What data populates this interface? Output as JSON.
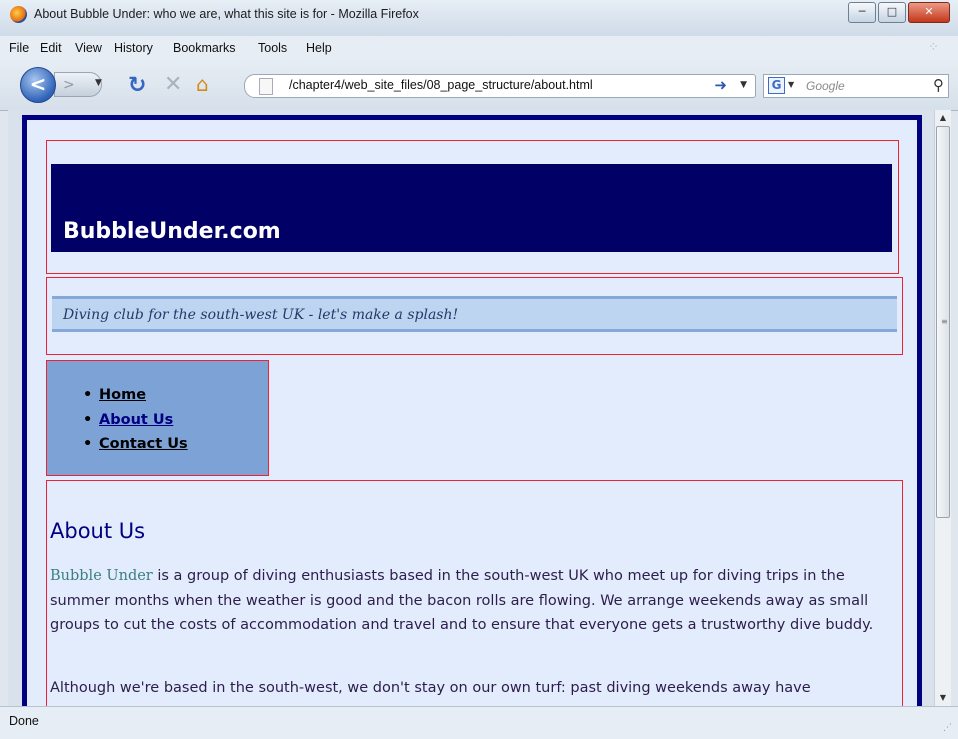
{
  "window": {
    "title": "About Bubble Under: who we are, what this site is for - Mozilla Firefox",
    "controls": {
      "minimize": "─",
      "maximize": "□",
      "close": "✕"
    }
  },
  "menubar": {
    "items": [
      "File",
      "Edit",
      "View",
      "History",
      "Bookmarks",
      "Tools",
      "Help"
    ]
  },
  "navbar": {
    "url": "/chapter4/web_site_files/08_page_structure/about.html",
    "search_placeholder": "Google",
    "search_engine_letter": "G"
  },
  "page": {
    "site_name": "BubbleUnder.com",
    "tagline": "Diving club for the south-west UK - let's make a splash!",
    "nav": [
      {
        "label": "Home"
      },
      {
        "label": "About Us"
      },
      {
        "label": "Contact Us"
      }
    ],
    "content": {
      "heading": "About Us",
      "brand": "Bubble Under",
      "p1_rest": " is a group of diving enthusiasts based in the south-west UK who meet up for diving trips in the summer months when the weather is good and the bacon rolls are flowing. We arrange weekends away as small groups to cut the costs of accommodation and travel and to ensure that everyone gets a trustworthy dive buddy.",
      "p2": "Although we're based in the south-west, we don't stay on our own turf: past diving weekends away have"
    }
  },
  "statusbar": {
    "text": "Done"
  },
  "colors": {
    "page_background": "#e3ecfc",
    "header_bar": "#000066",
    "border_accent": "#000080",
    "debug_outline": "#e22233",
    "nav_background": "#7da3d6",
    "tagline_band": "#bdd5f1",
    "brand_text": "#3a8080"
  },
  "icons": [
    "firefox-logo-icon",
    "back-arrow-icon",
    "forward-arrow-icon",
    "reload-icon",
    "stop-icon",
    "home-icon",
    "page-icon",
    "go-arrow-icon",
    "google-icon",
    "search-icon"
  ]
}
